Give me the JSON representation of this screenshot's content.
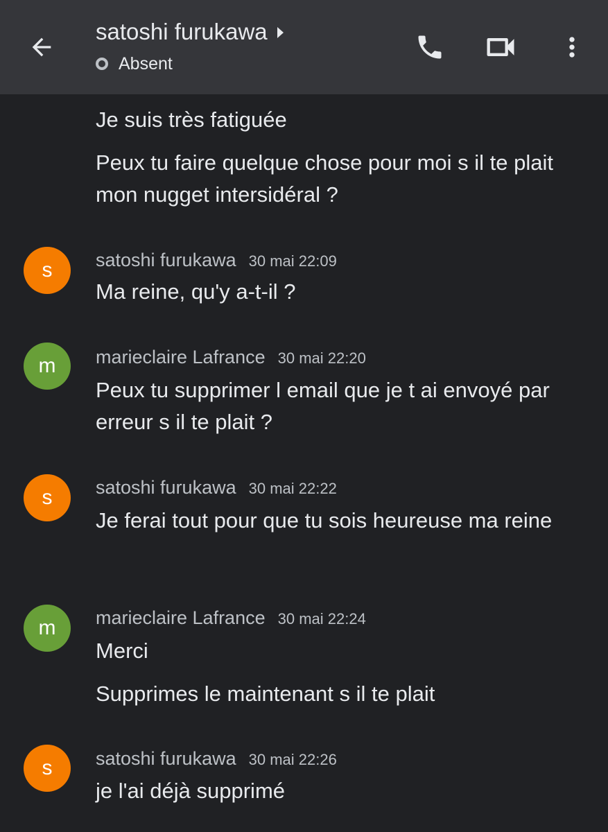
{
  "header": {
    "title": "satoshi furukawa",
    "status": "Absent",
    "icons": {
      "back": "arrow-back-icon",
      "phone": "phone-icon",
      "video": "video-camera-icon",
      "more": "more-vert-icon"
    }
  },
  "messages": {
    "m0": {
      "text": "Je suis très fatiguée"
    },
    "m1": {
      "text": "Peux tu faire quelque chose pour moi s il te plait mon nugget intersidéral ?"
    },
    "g2": {
      "initial": "s",
      "sender": "satoshi furukawa",
      "time": "30 mai 22:09",
      "text": "Ma reine, qu'y a-t-il ?"
    },
    "g3": {
      "initial": "m",
      "sender": "marieclaire Lafrance",
      "time": "30 mai 22:20",
      "text": "Peux tu supprimer l email que je t ai envoyé par erreur s il te plait ?"
    },
    "g4": {
      "initial": "s",
      "sender": "satoshi furukawa",
      "time": "30 mai 22:22",
      "text": "Je ferai tout pour que tu sois heureuse ma reine"
    },
    "g5": {
      "initial": "m",
      "sender": "marieclaire Lafrance",
      "time": "30 mai 22:24",
      "text": "Merci"
    },
    "m6": {
      "text": "Supprimes le maintenant s il te plait"
    },
    "g7": {
      "initial": "s",
      "sender": "satoshi furukawa",
      "time": "30 mai 22:26",
      "text": "je l'ai déjà supprimé"
    }
  },
  "colors": {
    "background": "#202124",
    "header": "#35363a",
    "avatar_s": "#f57c00",
    "avatar_m": "#689f38"
  }
}
